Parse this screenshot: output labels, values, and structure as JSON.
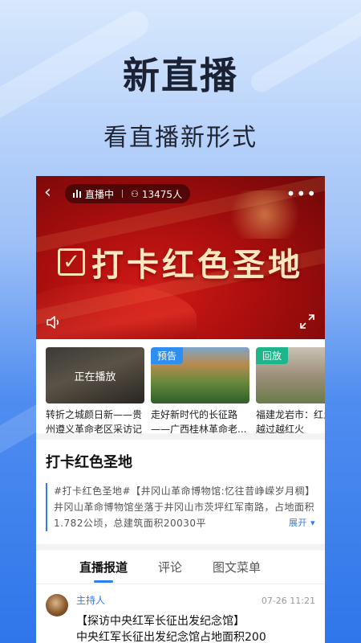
{
  "promo": {
    "headline": "新直播",
    "subline": "看直播新形式"
  },
  "player": {
    "status": "直播中",
    "viewers": "13475人",
    "banner_text": "打卡红色圣地",
    "icons": {
      "back": "back-icon",
      "more": "more-icon",
      "volume": "volume-icon",
      "fullscreen": "fullscreen-icon"
    }
  },
  "playlist": [
    {
      "title": "转折之城颜日新——贵州遵义革命老区采访记",
      "overlay": "正在播放",
      "tag": ""
    },
    {
      "title": "走好新时代的长征路——广西桂林革命老...",
      "overlay": "",
      "tag": "预告"
    },
    {
      "title": "福建龙岩市：红土日子越过越红火",
      "overlay": "",
      "tag": "回放"
    }
  ],
  "section": {
    "title": "打卡红色圣地",
    "description": "#打卡红色圣地#【井冈山革命博物馆:忆往昔峥嵘岁月稠】井冈山革命博物馆坐落于井冈山市茨坪红军南路，占地面积1.782公顷，总建筑面积20030平",
    "expand_label": "展开"
  },
  "tabs": [
    "直播报道",
    "评论",
    "图文菜单"
  ],
  "post": {
    "author": "主持人",
    "time": "07-26 11:21",
    "title": "【探访中央红军长征出发纪念馆】",
    "body": "中央红军长征出发纪念馆占地面积200"
  },
  "colors": {
    "accent": "#2f7cf6",
    "preview_tag": "#2f8ff0",
    "replay_tag": "#1fb58a",
    "banner_red": "#b81212"
  }
}
